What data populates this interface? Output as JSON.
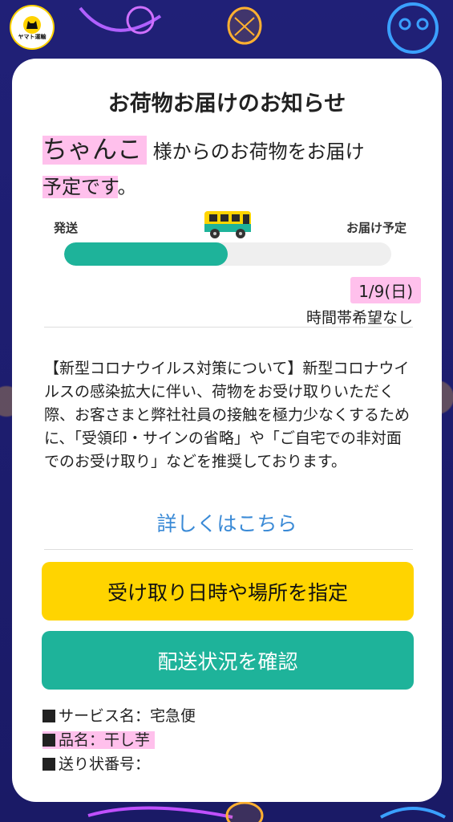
{
  "brand": {
    "logo_text": "ヤマト運輸"
  },
  "title": "お荷物お届けのお知らせ",
  "sender": {
    "name": "ちゃんこ",
    "text_1": "様からのお荷物をお届け",
    "text_2": "予定です",
    "text_3": "。"
  },
  "progress": {
    "label_start": "発送",
    "label_end": "お届け予定",
    "value": 0.5
  },
  "delivery": {
    "date": "1/9(日)",
    "time_preference": "時間帯希望なし"
  },
  "notice": "【新型コロナウイルス対策について】新型コロナウイルスの感染拡大に伴い、荷物をお受け取りいただく際、お客さまと弊社社員の接触を極力少なくするために、「受領印・サインの省略」や「ご自宅での非対面でのお受け取り」などを推奨しております。",
  "details_link": "詳しくはこちら",
  "buttons": {
    "specify": "受け取り日時や場所を指定",
    "status": "配送状況を確認"
  },
  "info": {
    "service": "サービス名：宅急便",
    "item": "品名：干し芋",
    "tracking": "送り状番号："
  },
  "colors": {
    "accent_green": "#1eb39a",
    "accent_yellow": "#ffd400",
    "link_blue": "#3a8ad6",
    "highlight_pink": "#ff8cdc",
    "background_navy": "#1b1b6e"
  }
}
